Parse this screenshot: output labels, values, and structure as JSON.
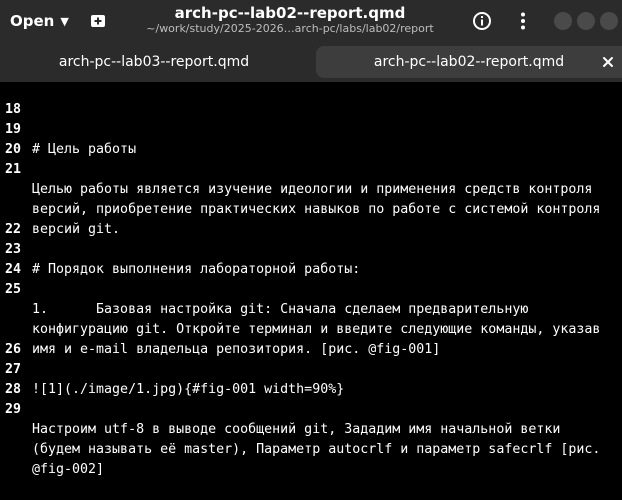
{
  "header": {
    "open_label": "Open",
    "title": "arch-pc--lab02--report.qmd",
    "subtitle": "~/work/study/2025-2026…arch-pc/labs/lab02/report"
  },
  "tabs": [
    {
      "label": "arch-pc--lab03--report.qmd",
      "active": false
    },
    {
      "label": "arch-pc--lab02--report.qmd",
      "active": true
    }
  ],
  "editor": {
    "lines": [
      {
        "n": "18",
        "text": ""
      },
      {
        "n": "19",
        "text": "# Цель работы"
      },
      {
        "n": "20",
        "text": ""
      },
      {
        "n": "21",
        "text": "Целью работы является изучение идеологии и применения средств контроля"
      },
      {
        "n": "",
        "text": "версий, приобретение практических навыков по работе с системой контроля"
      },
      {
        "n": "",
        "text": "версий git."
      },
      {
        "n": "22",
        "text": ""
      },
      {
        "n": "23",
        "text": "# Порядок выполнения лабораторной работы:"
      },
      {
        "n": "24",
        "text": ""
      },
      {
        "n": "25",
        "text": "1.      Базовая настройка git: Сначала сделаем предварительную"
      },
      {
        "n": "",
        "text": "конфигурацию git. Откройте терминал и введите следующие команды, указав"
      },
      {
        "n": "",
        "text": "имя и e-mail владельца репозитория. [рис. @fig-001]"
      },
      {
        "n": "26",
        "text": ""
      },
      {
        "n": "27",
        "text": "![1](./image/1.jpg){#fig-001 width=90%}"
      },
      {
        "n": "28",
        "text": ""
      },
      {
        "n": "29",
        "text": "Настроим utf-8 в выводе сообщений git, Зададим имя начальной ветки"
      },
      {
        "n": "",
        "text": "(будем называть её master), Параметр autocrlf и параметр safecrlf [рис."
      },
      {
        "n": "",
        "text": "@fig-002]"
      }
    ]
  },
  "colors": {
    "header_bg": "#2b2b2b",
    "active_tab_bg": "#3d3d3d",
    "editor_bg": "#000000",
    "text": "#ffffff",
    "spell_underline": "#d03b3b"
  }
}
